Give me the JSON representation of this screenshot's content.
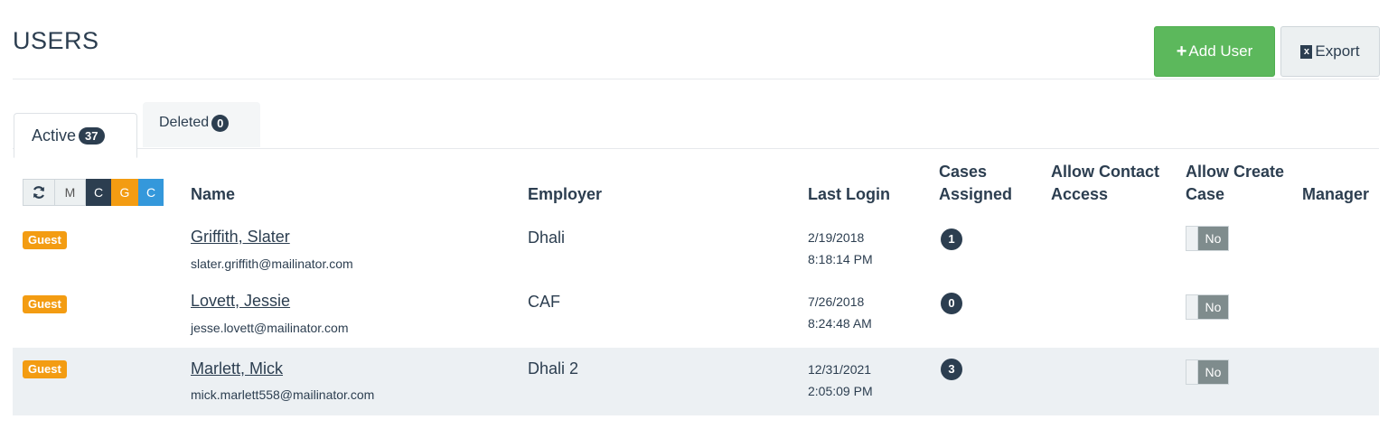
{
  "page": {
    "title": "USERS",
    "add_user_label": "Add User",
    "export_label": "Export",
    "add_icon": "plus-icon",
    "export_icon": "excel-icon"
  },
  "tabs": [
    {
      "label": "Active",
      "count": "37"
    },
    {
      "label": "Deleted",
      "count": "0"
    }
  ],
  "filters": {
    "refresh_icon": "refresh-icon",
    "buttons": [
      {
        "label": "M"
      },
      {
        "label": "C"
      },
      {
        "label": "G"
      },
      {
        "label": "C"
      }
    ]
  },
  "table": {
    "headers": {
      "name": "Name",
      "employer": "Employer",
      "last_login": "Last Login",
      "cases_assigned_1": "Cases",
      "cases_assigned_2": "Assigned",
      "allow_contact_1": "Allow Contact",
      "allow_contact_2": "Access",
      "allow_create_1": "Allow Create",
      "allow_create_2": "Case",
      "manager": "Manager"
    },
    "rows": [
      {
        "badge": "Guest",
        "name": "Griffith, Slater",
        "email": "slater.griffith@mailinator.com",
        "employer": "Dhali",
        "login_date": "2/19/2018",
        "login_time": "8:18:14 PM",
        "cases": "1",
        "allow_create": "No"
      },
      {
        "badge": "Guest",
        "name": "Lovett, Jessie",
        "email": "jesse.lovett@mailinator.com",
        "employer": "CAF",
        "login_date": "7/26/2018",
        "login_time": "8:24:48 AM",
        "cases": "0",
        "allow_create": "No"
      },
      {
        "badge": "Guest",
        "name": "Marlett, Mick",
        "email": "mick.marlett558@mailinator.com",
        "employer": "Dhali 2",
        "login_date": "12/31/2021",
        "login_time": "2:05:09 PM",
        "cases": "3",
        "allow_create": "No"
      }
    ]
  },
  "colors": {
    "primary": "#2c3e50",
    "success": "#5cb85c",
    "warning": "#f39c12",
    "info": "#3498db",
    "muted_bg": "#ecf0f1"
  }
}
